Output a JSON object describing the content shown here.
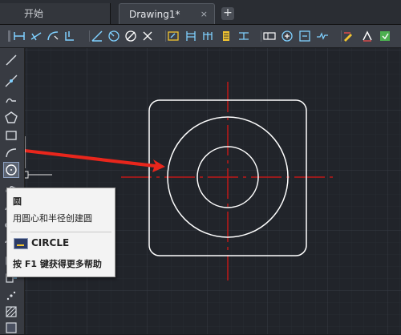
{
  "tabs": [
    {
      "label": "开始",
      "active": false
    },
    {
      "label": "Drawing1*",
      "active": true
    }
  ],
  "tab_close_icon": "×",
  "tab_add_icon": "+",
  "toolbar": {
    "icons": [
      "grip-icon",
      "ortho-icon",
      "arc-dim-icon",
      "linear-dim-icon",
      "ordinate-icon",
      "angular-dim-icon",
      "radius-dim-icon",
      "diameter-dim-icon",
      "jog-icon",
      "continue-dim-icon",
      "baseline-dim-icon",
      "quick-dim-icon",
      "tolerance-icon",
      "center-mark-icon",
      "inspect-icon",
      "jogged-linear-icon",
      "dim-edit-icon",
      "dim-text-edit-icon",
      "dim-update-icon",
      "dim-style-icon"
    ]
  },
  "left_tools": [
    "line-icon",
    "construction-line-icon",
    "polyline-icon",
    "polygon-icon",
    "rectangle-icon",
    "arc-icon",
    "circle-icon",
    "revcloud-icon",
    "spline-icon",
    "ellipse-icon",
    "insert-block-icon",
    "point-icon",
    "hatch-icon",
    "gradient-icon"
  ],
  "tooltip": {
    "title": "圆",
    "description": "用圆心和半径创建圆",
    "command": "CIRCLE",
    "help": "按 F1 键获得更多帮助"
  },
  "colors": {
    "canvas_bg": "#21242a",
    "grid": "#2c3038",
    "geometry": "#ffffff",
    "centerline": "#c01818",
    "arrow": "#e8261c"
  }
}
